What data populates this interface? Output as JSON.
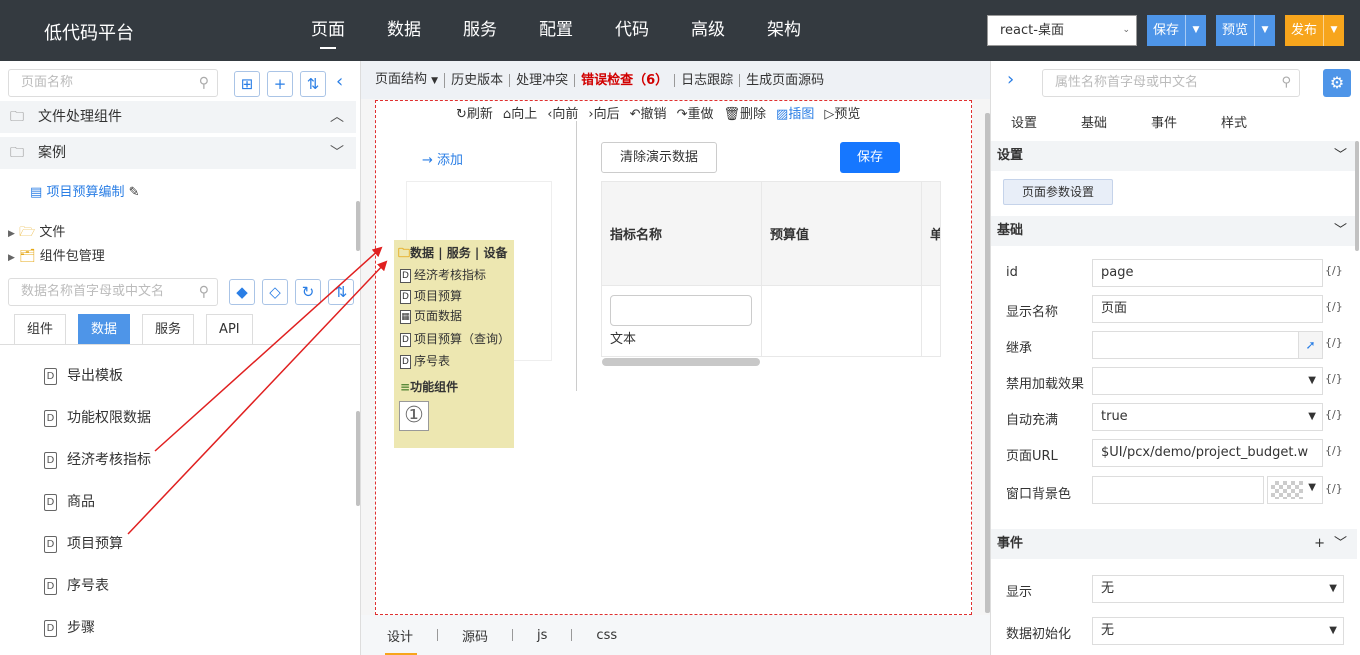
{
  "app": {
    "title": "低代码平台"
  },
  "topnav": {
    "items": [
      "页面",
      "数据",
      "服务",
      "配置",
      "代码",
      "高级",
      "架构"
    ]
  },
  "env_select": {
    "value": "react-桌面"
  },
  "header_buttons": {
    "save": "保存",
    "preview": "预览",
    "publish": "发布"
  },
  "colors": {
    "accent": "#4e95e8",
    "publish": "#f7a51c",
    "error": "#d10000",
    "topbar": "#343a40"
  },
  "left": {
    "page_search_placeholder": "页面名称",
    "groups": {
      "file_components": "文件处理组件",
      "examples": "案例"
    },
    "page_link": "项目预算编制",
    "tree": {
      "files": "文件",
      "packages": "组件包管理"
    },
    "data_search_placeholder": "数据名称首字母或中文名",
    "tabs": [
      "组件",
      "数据",
      "服务",
      "API"
    ],
    "data_items": [
      "导出模板",
      "功能权限数据",
      "经济考核指标",
      "商品",
      "项目预算",
      "序号表",
      "步骤"
    ]
  },
  "center": {
    "toolbar": {
      "structure": "页面结构",
      "history": "历史版本",
      "conflict": "处理冲突",
      "error_check": "错误检查（6）",
      "log": "日志跟踪",
      "generate": "生成页面源码"
    },
    "actions": [
      "刷新",
      "向上",
      "向前",
      "向后",
      "撤销",
      "重做",
      "删除",
      "插图",
      "预览"
    ],
    "add": "添加",
    "clear_demo": "清除演示数据",
    "save": "保存",
    "grid_headers": [
      "指标名称",
      "预算值",
      "单"
    ],
    "cell_text": "文本",
    "popup": {
      "header": "数据 | 服务 | 设备",
      "items": [
        "经济考核指标",
        "项目预算",
        "页面数据",
        "项目预算（查询）",
        "序号表"
      ],
      "section": "功能组件",
      "circle": "①"
    },
    "bottom_tabs": [
      "设计",
      "源码",
      "js",
      "css"
    ]
  },
  "right": {
    "search_placeholder": "属性名称首字母或中文名",
    "tabs": [
      "设置",
      "基础",
      "事件",
      "样式"
    ],
    "sections": {
      "settings": "设置",
      "basic": "基础",
      "events": "事件"
    },
    "param_button": "页面参数设置",
    "expr": "{/}",
    "props": {
      "id": {
        "label": "id",
        "value": "page"
      },
      "display_name": {
        "label": "显示名称",
        "value": "页面"
      },
      "inherit": {
        "label": "继承",
        "value": ""
      },
      "disable_loading": {
        "label": "禁用加载效果",
        "value": ""
      },
      "auto_fill": {
        "label": "自动充满",
        "value": "true"
      },
      "page_url": {
        "label": "页面URL",
        "value": "$UI/pcx/demo/project_budget.w"
      },
      "bg_color": {
        "label": "窗口背景色",
        "value": ""
      }
    },
    "events": {
      "show": {
        "label": "显示",
        "value": "无"
      },
      "data_init": {
        "label": "数据初始化",
        "value": "无"
      }
    }
  }
}
